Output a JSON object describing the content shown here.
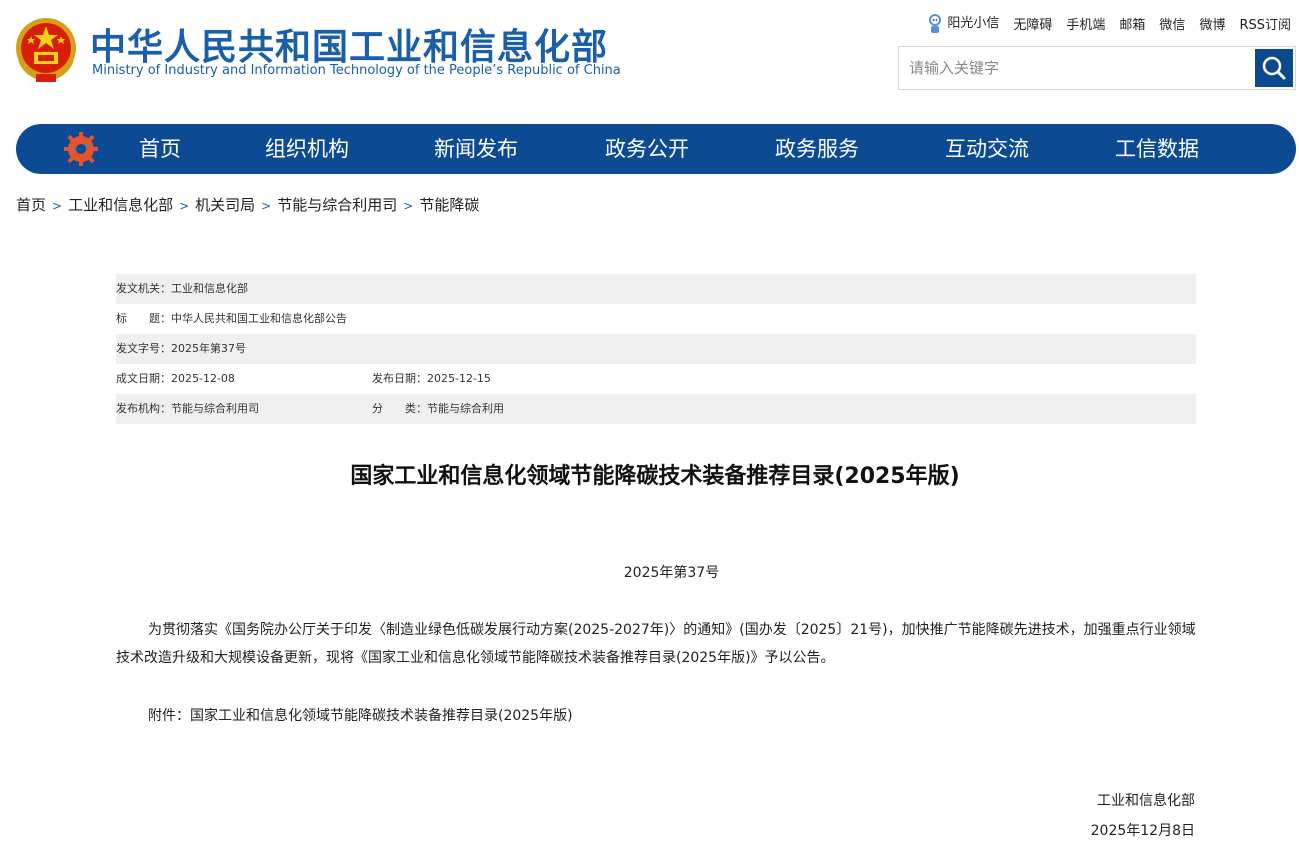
{
  "header": {
    "title_cn": "中华人民共和国工业和信息化部",
    "title_en": "Ministry of Industry and Information Technology of the People’s Republic of China",
    "emblem_icon": "national-emblem-icon",
    "brand_color": "#1a5fa8"
  },
  "toplinks": [
    "阳光小信",
    "无障碍",
    "手机端",
    "邮箱",
    "微信",
    "微博",
    "RSS订阅"
  ],
  "search": {
    "placeholder": "请输入关键字",
    "button_icon": "search-icon"
  },
  "nav": {
    "color": "#0c4a93",
    "items": [
      "首页",
      "组织机构",
      "新闻发布",
      "政务公开",
      "政务服务",
      "互动交流",
      "工信数据"
    ]
  },
  "breadcrumb": [
    "首页",
    "工业和信息化部",
    "机关司局",
    "节能与综合利用司",
    "节能降碳"
  ],
  "meta": {
    "issuer_label": "发文机关：",
    "issuer": "工业和信息化部",
    "title_label": "标　　题：",
    "title": "中华人民共和国工业和信息化部公告",
    "docno_label": "发文字号：",
    "docno": "2025年第37号",
    "written_label": "成文日期：",
    "written": "2025-12-08",
    "published_label": "发布日期：",
    "published": "2025-12-15",
    "org_label": "发布机构：",
    "org": "节能与综合利用司",
    "category_label": "分　　类：",
    "category": "节能与综合利用"
  },
  "article": {
    "title": "国家工业和信息化领域节能降碳技术装备推荐目录(2025年版)",
    "docno": "2025年第37号",
    "para1": "为贯彻落实《国务院办公厅关于印发〈制造业绿色低碳发展行动方案(2025-2027年)〉的通知》(国办发〔2025〕21号)，加快推广节能降碳先进技术，加强重点行业领域技术改造升级和大规模设备更新，现将《国家工业和信息化领域节能降碳技术装备推荐目录(2025年版)》予以公告。",
    "para2": "附件：国家工业和信息化领域节能降碳技术装备推荐目录(2025年版)",
    "signer": "工业和信息化部",
    "date": "2025年12月8日"
  }
}
